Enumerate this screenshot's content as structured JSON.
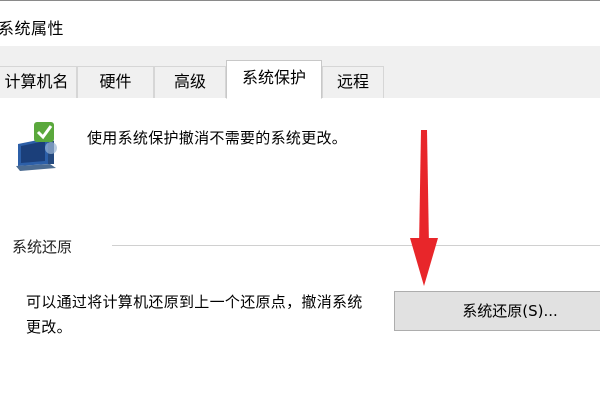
{
  "window": {
    "title": "系统属性"
  },
  "tabs": [
    {
      "label": "计算机名"
    },
    {
      "label": "硬件"
    },
    {
      "label": "高级"
    },
    {
      "label": "系统保护"
    },
    {
      "label": "远程"
    }
  ],
  "active_tab": "系统保护",
  "protection": {
    "description": "使用系统保护撤消不需要的系统更改。"
  },
  "restore": {
    "group_label": "系统还原",
    "description": "可以通过将计算机还原到上一个还原点，撤消系统更改。",
    "button_label": "系统还原(S)..."
  },
  "colors": {
    "annotation_arrow": "#e8262a",
    "button_bg": "#e1e1e1"
  },
  "icons": {
    "system_protection": "computer-shield-icon",
    "annotation": "red-arrow-down"
  }
}
